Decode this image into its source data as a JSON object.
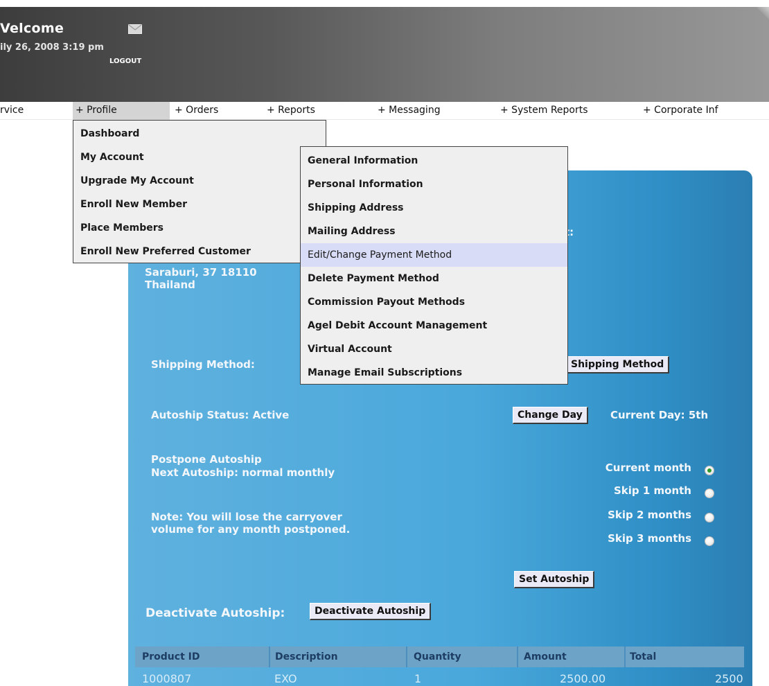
{
  "header": {
    "welcome": "Velcome",
    "datetime": "ily 26, 2008 3:19 pm",
    "logout": "LOGOUT"
  },
  "nav": {
    "items": [
      {
        "label": "rvice"
      },
      {
        "label": "+ Profile"
      },
      {
        "label": "+ Orders"
      },
      {
        "label": "+ Reports"
      },
      {
        "label": "+ Messaging"
      },
      {
        "label": "+ System Reports"
      },
      {
        "label": "+ Corporate Inf"
      }
    ]
  },
  "profile_menu": {
    "items": [
      {
        "label": "Dashboard"
      },
      {
        "label": "My Account"
      },
      {
        "label": "Upgrade My Account"
      },
      {
        "label": "Enroll New Member"
      },
      {
        "label": "Place Members"
      },
      {
        "label": "Enroll New Preferred Customer"
      }
    ]
  },
  "account_menu": {
    "items": [
      {
        "label": "General Information"
      },
      {
        "label": "Personal Information"
      },
      {
        "label": "Shipping Address"
      },
      {
        "label": "Mailing Address"
      },
      {
        "label": "Edit/Change Payment Method"
      },
      {
        "label": "Delete Payment Method"
      },
      {
        "label": "Commission Payout Methods"
      },
      {
        "label": "Agel Debit Account Management"
      },
      {
        "label": "Virtual Account"
      },
      {
        "label": "Manage Email Subscriptions"
      }
    ]
  },
  "panel": {
    "partial_label": "t:",
    "address_line1": "Saraburi, 37  18110",
    "address_line2": "Thailand",
    "shipping_method_label": "Shipping Method:",
    "shipping_method_button": "Shipping Method",
    "autoship_status": "Autoship Status: Active",
    "change_day_button": "Change Day",
    "current_day": "Current Day: 5th",
    "postpone_title": "Postpone Autoship",
    "next_autoship": "Next Autoship: normal monthly",
    "note_line1": "Note: You will lose the carryover",
    "note_line2": "volume for any month postponed.",
    "postpone_options": [
      {
        "label": "Current month",
        "checked": true
      },
      {
        "label": "Skip 1 month",
        "checked": false
      },
      {
        "label": "Skip 2 months",
        "checked": false
      },
      {
        "label": "Skip 3 months",
        "checked": false
      }
    ],
    "set_autoship_button": "Set Autoship",
    "deactivate_label": "Deactivate Autoship:",
    "deactivate_button": "Deactivate Autoship"
  },
  "table": {
    "headers": [
      "Product ID",
      "Description",
      "Quantity",
      "Amount",
      "Total"
    ],
    "rows": [
      [
        "1000807",
        "EXO",
        "1",
        "2500.00",
        "2500"
      ]
    ]
  }
}
